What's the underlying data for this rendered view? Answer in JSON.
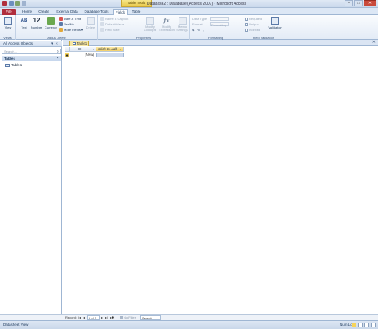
{
  "title_bar": {
    "context_tab": "Table Tools",
    "window_title": "Database2 : Database (Access 2007) - Microsoft Access",
    "controls": {
      "minimize": "–",
      "maximize": "□",
      "close": "✕"
    }
  },
  "tabs": {
    "file": "File",
    "home": "Home",
    "create": "Create",
    "external": "External Data",
    "dbtools": "Database Tools",
    "fields": "Fields",
    "table": "Table"
  },
  "ribbon": {
    "views": {
      "view": "View",
      "label": "Views"
    },
    "add_delete": {
      "text": "Text",
      "number": "Number",
      "currency": "Currency",
      "text_icon": "AB",
      "number_icon": "12",
      "date_time": "Date & Time",
      "yes_no": "Yes/No",
      "more_fields": "More Fields ▾",
      "delete": "Delete",
      "label": "Add & Delete"
    },
    "properties": {
      "name_caption": "Name & Caption",
      "default_value": "Default Value",
      "field_size": "Field Size",
      "modify_lookups": "Modify Lookups",
      "modify_expression": "Modify Expression",
      "memo_settings": "Memo Settings",
      "fx": "fx",
      "label": "Properties"
    },
    "formatting": {
      "data_type": "Data Type:",
      "format": "Format:",
      "format_value": "Formatting",
      "symbols": [
        "$",
        "%",
        ","
      ],
      "label": "Formatting"
    },
    "field_validation": {
      "required": "Required",
      "unique": "Unique",
      "indexed": "Indexed",
      "validation": "Validation",
      "label": "Field Validation"
    }
  },
  "nav_pane": {
    "header": "All Access Objects",
    "header_dropdown": "▾",
    "header_collapse": "«",
    "search_placeholder": "Search...",
    "search_icon": "⌕",
    "group": "Tables",
    "group_toggle": "⌃",
    "items": [
      "Table1"
    ]
  },
  "document": {
    "tab": "Table1",
    "close": "✕",
    "columns": {
      "id": "ID",
      "add": "Click to Add"
    },
    "new_row": "(New)",
    "selector_mark": "✱"
  },
  "record_nav": {
    "label": "Record:",
    "first": "|◂",
    "prev": "◂",
    "position": "1 of 1",
    "next": "▸",
    "last": "▸|",
    "new": "▸✱",
    "filter": "No Filter",
    "search": "Search"
  },
  "status_bar": {
    "view": "Datasheet View",
    "num_lock": "Num Lock"
  },
  "colors": {
    "file_tab": "#b02e3d",
    "context": "#e9c94a",
    "accent": "#2a4f8a"
  }
}
